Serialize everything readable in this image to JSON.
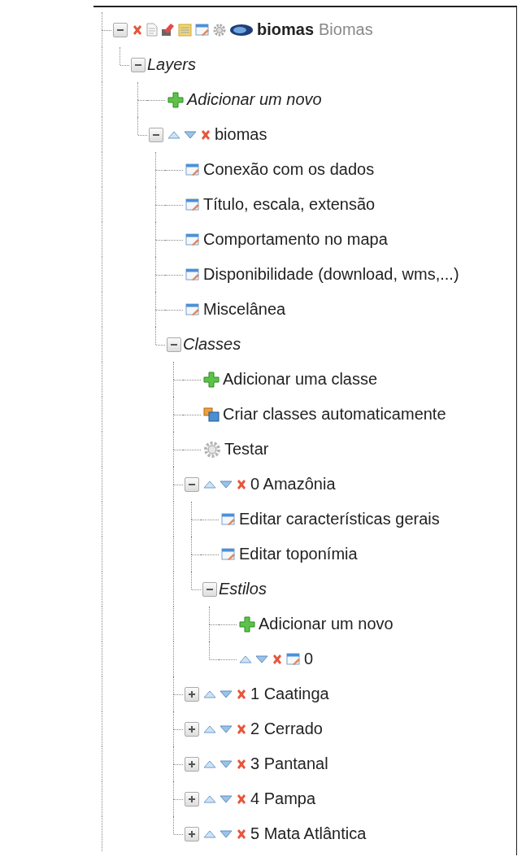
{
  "tree": [
    {
      "kind": "root",
      "label": "biomas",
      "subtitle": "Biomas",
      "expanded": true,
      "children": [
        {
          "kind": "group",
          "label": "Layers",
          "expanded": true,
          "children": [
            {
              "kind": "new-layer",
              "label": "Adicionar um novo"
            },
            {
              "kind": "layer",
              "label": "biomas",
              "expanded": true,
              "children": [
                {
                  "kind": "form",
                  "label": "Conexão com os dados"
                },
                {
                  "kind": "form",
                  "label": "Título, escala, extensão"
                },
                {
                  "kind": "form",
                  "label": "Comportamento no mapa"
                },
                {
                  "kind": "form",
                  "label": "Disponibilidade (download, wms,...)"
                },
                {
                  "kind": "form",
                  "label": "Miscelânea"
                },
                {
                  "kind": "group",
                  "label": "Classes",
                  "expanded": true,
                  "children": [
                    {
                      "kind": "add",
                      "label": "Adicionar uma classe"
                    },
                    {
                      "kind": "auto",
                      "label": "Criar classes automaticamente"
                    },
                    {
                      "kind": "test",
                      "label": "Testar"
                    },
                    {
                      "kind": "class",
                      "label": "0 Amazônia",
                      "expanded": true,
                      "children": [
                        {
                          "kind": "form",
                          "label": "Editar características gerais"
                        },
                        {
                          "kind": "form",
                          "label": "Editar toponímia"
                        },
                        {
                          "kind": "group",
                          "label": "Estilos",
                          "expanded": true,
                          "children": [
                            {
                              "kind": "add",
                              "label": "Adicionar um novo"
                            },
                            {
                              "kind": "style",
                              "label": "0"
                            }
                          ]
                        }
                      ]
                    },
                    {
                      "kind": "class",
                      "label": "1 Caatinga",
                      "expanded": false
                    },
                    {
                      "kind": "class",
                      "label": "2 Cerrado",
                      "expanded": false
                    },
                    {
                      "kind": "class",
                      "label": "3 Pantanal",
                      "expanded": false
                    },
                    {
                      "kind": "class",
                      "label": "4 Pampa",
                      "expanded": false
                    },
                    {
                      "kind": "class",
                      "label": "5 Mata Atlântica",
                      "expanded": false
                    }
                  ]
                }
              ]
            }
          ]
        }
      ]
    }
  ]
}
